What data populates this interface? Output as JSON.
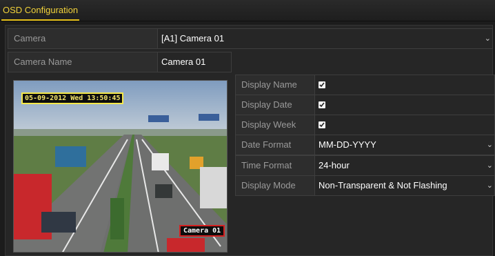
{
  "tab": {
    "label": "OSD Configuration"
  },
  "camera": {
    "label": "Camera",
    "value": "[A1] Camera 01"
  },
  "camera_name": {
    "label": "Camera Name",
    "value": "Camera 01"
  },
  "settings": [
    {
      "label": "Display Name",
      "type": "checkbox",
      "checked": true
    },
    {
      "label": "Display Date",
      "type": "checkbox",
      "checked": true
    },
    {
      "label": "Display Week",
      "type": "checkbox",
      "checked": true
    },
    {
      "label": "Date Format",
      "type": "select",
      "value": "MM-DD-YYYY"
    },
    {
      "label": "Time Format",
      "type": "select",
      "value": "24-hour"
    },
    {
      "label": "Display Mode",
      "type": "select",
      "value": "Non-Transparent & Not Flashing"
    }
  ],
  "preview": {
    "osd_datetime": "05-09-2012 Wed 13:50:45",
    "osd_camera_name": "Camera 01"
  },
  "colors": {
    "accent": "#e8c21c",
    "osd_date_border": "#f6e94a",
    "osd_name_border": "#d42020"
  },
  "icons": {
    "dropdown": "chevron-down-icon",
    "checkbox": "checkmark-icon"
  }
}
